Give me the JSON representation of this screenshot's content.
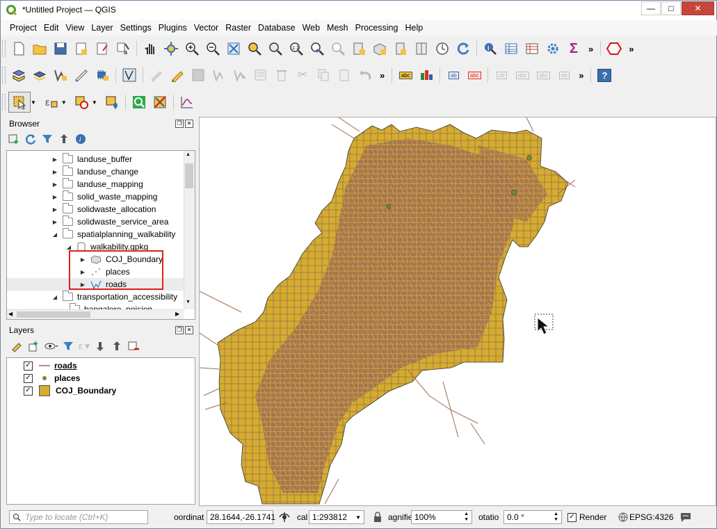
{
  "window": {
    "title": "*Untitled Project — QGIS"
  },
  "menu": [
    "Project",
    "Edit",
    "View",
    "Layer",
    "Settings",
    "Plugins",
    "Vector",
    "Raster",
    "Database",
    "Web",
    "Mesh",
    "Processing",
    "Help"
  ],
  "browser": {
    "title": "Browser",
    "items": [
      {
        "label": "landuse_buffer"
      },
      {
        "label": "landuse_change"
      },
      {
        "label": "landuse_mapping"
      },
      {
        "label": "solid_waste_mapping"
      },
      {
        "label": "solidwaste_allocation"
      },
      {
        "label": "solidwaste_service_area"
      },
      {
        "label": "spatialplanning_walkability"
      },
      {
        "label": "walkability.gpkg"
      },
      {
        "label": "COJ_Boundary"
      },
      {
        "label": "places"
      },
      {
        "label": "roads"
      },
      {
        "label": "transportation_accessibility"
      },
      {
        "label": "bangalore_poision"
      }
    ]
  },
  "layers": {
    "title": "Layers",
    "items": [
      {
        "label": "roads",
        "checked": "✓"
      },
      {
        "label": "places",
        "checked": "✓"
      },
      {
        "label": "COJ_Boundary",
        "checked": "✓"
      }
    ]
  },
  "status": {
    "locate_placeholder": "Type to locate (Ctrl+K)",
    "coord_label": "oordinat",
    "coord_value": "28.1644,-26.1741",
    "scale_label": "cal",
    "scale_value": "1:293812",
    "mag_label": "agnifie",
    "mag_value": "100%",
    "rot_label": "otatio",
    "rot_value": "0.0 °",
    "render_label": "Render",
    "crs": "EPSG:4326"
  },
  "colors": {
    "boundary_fill": "#d4ad2e",
    "roads": "#9c6b4f",
    "highlight_box": "#e0201c"
  }
}
